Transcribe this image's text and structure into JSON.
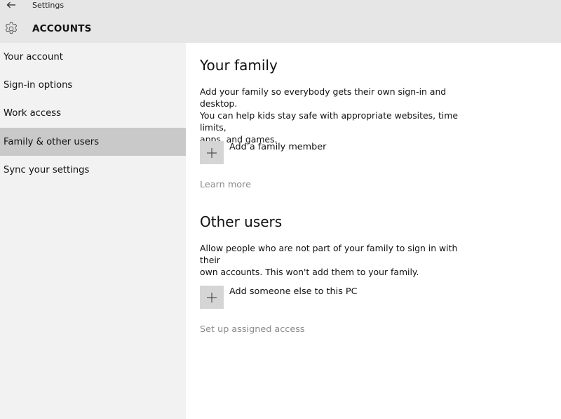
{
  "window": {
    "title": "Settings",
    "back_icon": "back-arrow-icon"
  },
  "header": {
    "section_title": "ACCOUNTS",
    "icon": "gear-icon"
  },
  "sidebar": {
    "items": [
      {
        "label": "Your account",
        "selected": false
      },
      {
        "label": "Sign-in options",
        "selected": false
      },
      {
        "label": "Work access",
        "selected": false
      },
      {
        "label": "Family & other users",
        "selected": true
      },
      {
        "label": "Sync your settings",
        "selected": false
      }
    ]
  },
  "family": {
    "heading": "Your family",
    "description_lines": [
      "Add your family so everybody gets their own sign-in and desktop.",
      "You can help kids stay safe with appropriate websites, time limits,",
      "apps, and games."
    ],
    "add_label": "Add a family member",
    "learn_more": "Learn more"
  },
  "others": {
    "heading": "Other users",
    "description_lines": [
      "Allow people who are not part of your family to sign in with their",
      "own accounts. This won't add them to your family."
    ],
    "add_label": "Add someone else to this PC",
    "assigned_access": "Set up assigned access"
  },
  "colors": {
    "topbar_bg": "#e6e6e6",
    "sidebar_bg": "#f2f2f2",
    "selected_bg": "#c9c9c9",
    "add_button_bg": "#d5d5d5",
    "link_color": "#8a8a8a"
  }
}
